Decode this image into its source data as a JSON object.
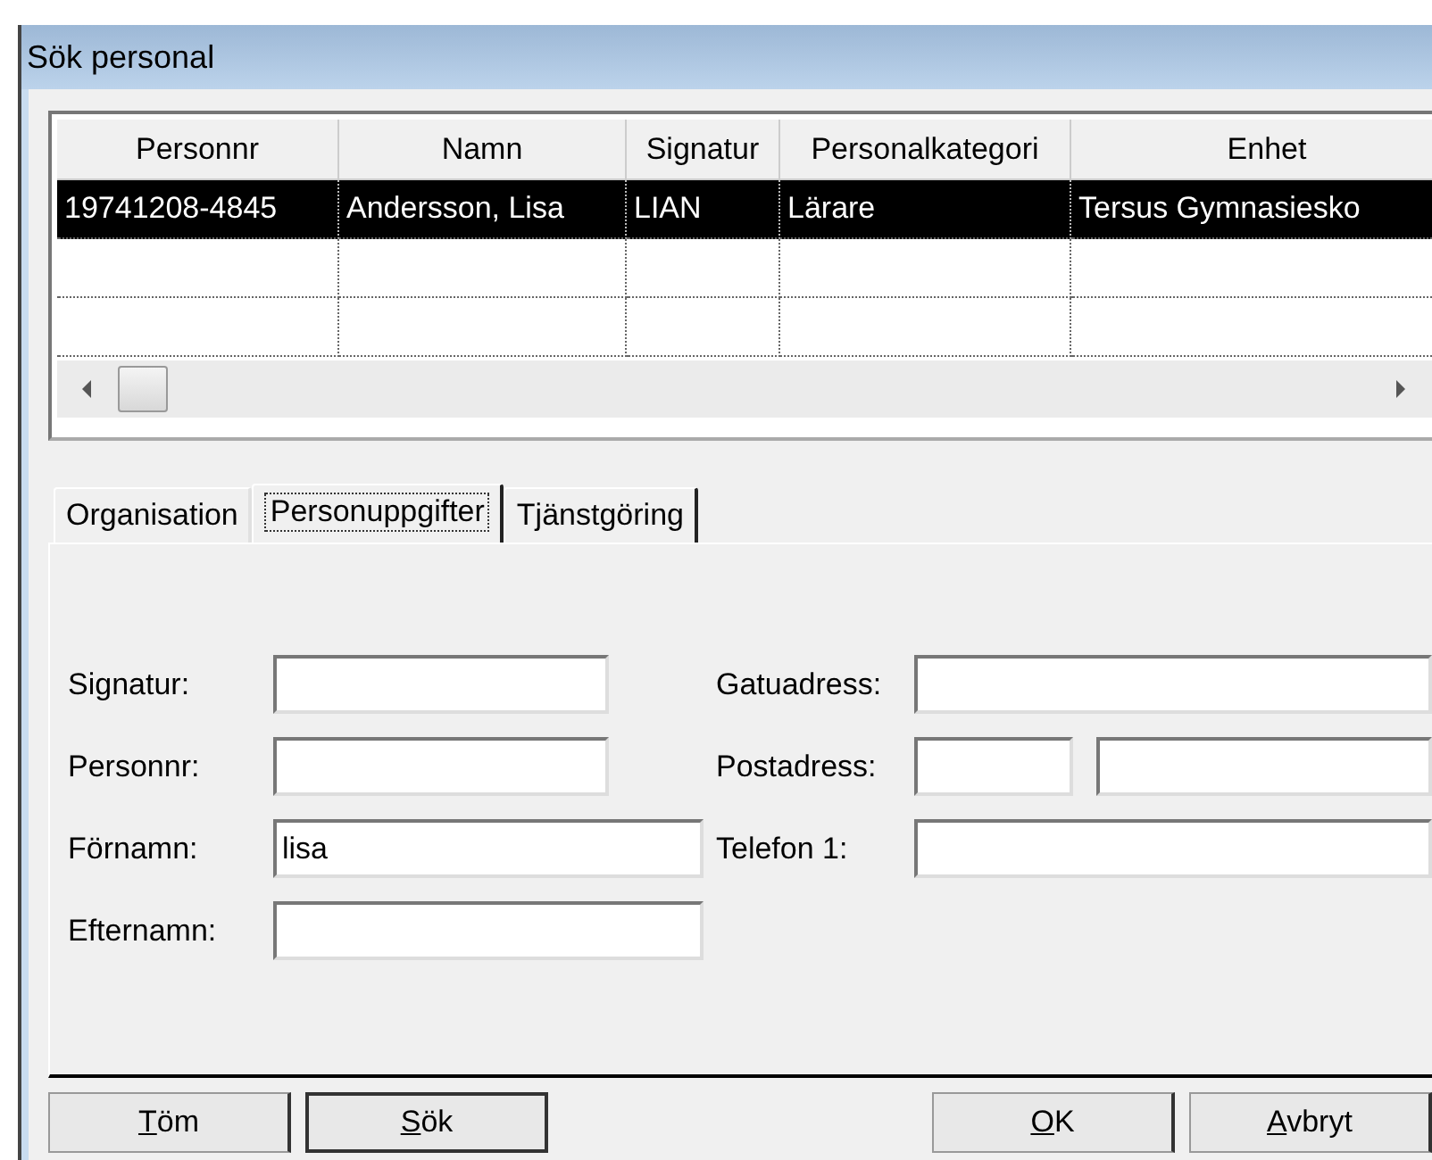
{
  "window": {
    "title": "Sök personal"
  },
  "table": {
    "columns": [
      "Personnr",
      "Namn",
      "Signatur",
      "Personalkategori",
      "Enhet"
    ],
    "rows": [
      {
        "cells": [
          "19741208-4845",
          "Andersson, Lisa",
          "LIAN",
          "Lärare",
          "Tersus Gymnasiesko"
        ],
        "selected": true
      }
    ]
  },
  "tabs": [
    {
      "label": "Organisation",
      "selected": false
    },
    {
      "label": "Personuppgifter",
      "selected": true
    },
    {
      "label": "Tjänstgöring",
      "selected": false
    }
  ],
  "form": {
    "left": [
      {
        "label": "Signatur:",
        "kind": "short"
      },
      {
        "label": "Personnr:",
        "kind": "short"
      },
      {
        "label": "Förnamn:",
        "kind": "long",
        "value": "lisa"
      },
      {
        "label": "Efternamn:",
        "kind": "long"
      }
    ],
    "right": [
      {
        "label": "Gatuadress:",
        "kind": "full"
      },
      {
        "label": "Postadress:",
        "kind": "pair"
      },
      {
        "label": "Telefon 1:",
        "kind": "full"
      }
    ]
  },
  "buttons": {
    "left": [
      {
        "label": "Töm",
        "default": false
      },
      {
        "label": "Sök",
        "default": true
      }
    ],
    "right": [
      {
        "label": "OK",
        "default": false
      },
      {
        "label": "Avbryt",
        "default": false
      }
    ]
  }
}
